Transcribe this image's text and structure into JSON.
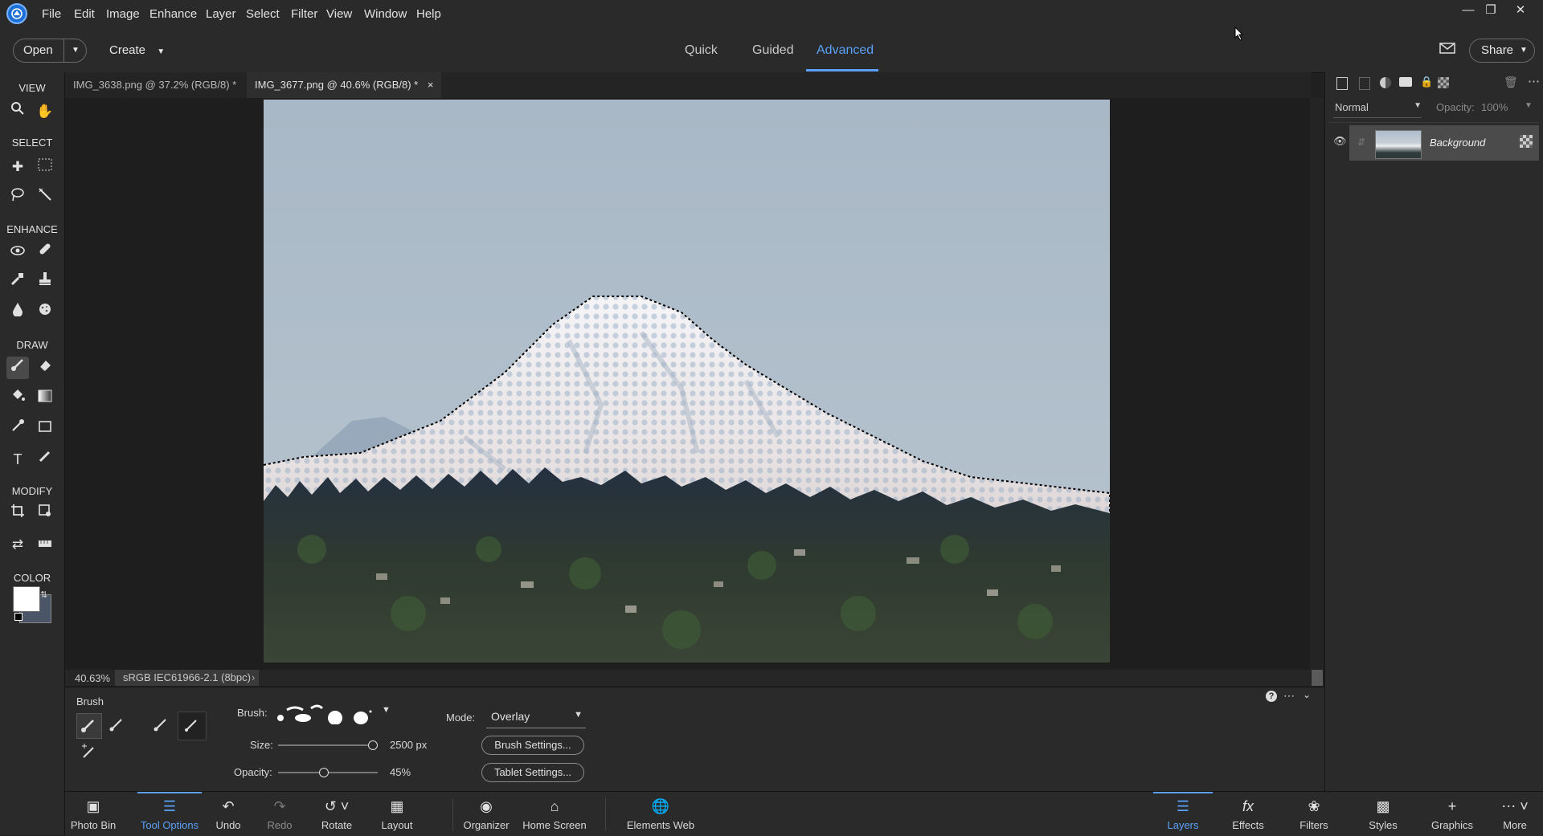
{
  "menubar": {
    "items": [
      "File",
      "Edit",
      "Image",
      "Enhance",
      "Layer",
      "Select",
      "Filter",
      "View",
      "Window",
      "Help"
    ]
  },
  "modebar": {
    "open_label": "Open",
    "create_label": "Create",
    "modes": [
      "Quick",
      "Guided",
      "Advanced"
    ],
    "active_mode": "Advanced",
    "share_label": "Share"
  },
  "toolbar": {
    "sections": {
      "view": "VIEW",
      "select": "SELECT",
      "enhance": "ENHANCE",
      "draw": "DRAW",
      "modify": "MODIFY",
      "color": "COLOR"
    },
    "foreground_color": "#ffffff",
    "background_color": "#4a5568"
  },
  "doc_tabs": [
    {
      "label": "IMG_3638.png @ 37.2% (RGB/8) *",
      "close": "×"
    },
    {
      "label": "IMG_3677.png @ 40.6% (RGB/8) *",
      "close": "×"
    }
  ],
  "status": {
    "zoom": "40.63%",
    "profile": "sRGB IEC61966-2.1 (8bpc)",
    "arrow": "›"
  },
  "options": {
    "tool_name": "Brush",
    "brush_label": "Brush:",
    "mode_label": "Mode:",
    "mode_value": "Overlay",
    "size_label": "Size:",
    "size_value": "2500 px",
    "size_fraction": 0.98,
    "opacity_label": "Opacity:",
    "opacity_value": "45%",
    "opacity_fraction": 0.45,
    "brush_settings": "Brush Settings...",
    "tablet_settings": "Tablet Settings..."
  },
  "layers_panel": {
    "blend_mode": "Normal",
    "opacity_label": "Opacity:",
    "opacity_value": "100%",
    "layer_name": "Background"
  },
  "bottombar": {
    "left": [
      "Photo Bin",
      "Tool Options",
      "Undo",
      "Redo",
      "Rotate",
      "Layout",
      "Organizer",
      "Home Screen",
      "Elements Web"
    ],
    "right": [
      "Layers",
      "Effects",
      "Filters",
      "Styles",
      "Graphics",
      "More"
    ],
    "active_left": "Tool Options",
    "active_right": "Layers"
  }
}
